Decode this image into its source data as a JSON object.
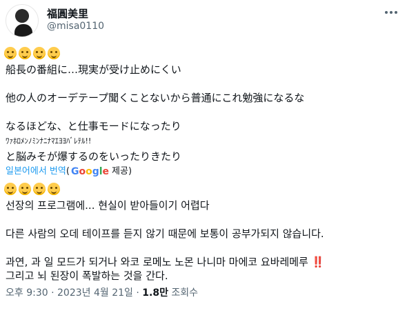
{
  "user": {
    "name": "福圓美里",
    "handle": "@misa0110"
  },
  "tweet": {
    "original": [
      "船長の番組に…現実が受け止めにくい",
      "他の人のオーデテープ聞くことないから普通にこれ勉強になるな",
      "なるほどな、と仕事モードになったり",
      "ﾜｧﾎﾛﾒﾝﾉﾐﾝﾅﾆﾅﾏｴﾖﾖﾊﾞﾚﾃﾙ!!",
      "と脳みそが爆するのをいったりきたり"
    ],
    "translate_link": "일본어에서 번역",
    "translate_prefix": "(",
    "google_letters": [
      "G",
      "o",
      "o",
      "g",
      "l",
      "e"
    ],
    "translate_suffix": "제공)",
    "translated": [
      "선장의 프로그램에... 현실이 받아들이기 어렵다",
      "다른 사람의 오데 테이프를 듣지 않기 때문에 보통이 공부가되지 않습니다.",
      "과연, 과 일 모드가 되거나 와코 로메노 노몬 나니마 마에코 요바레메루",
      "그리고 뇌 된장이 폭발하는 것을 간다."
    ],
    "bang": "‼️"
  },
  "meta": {
    "time": "오후 9:30",
    "sep1": "·",
    "date": "2023년 4월 21일",
    "sep2": "·",
    "views": "1.8만",
    "views_label": "조회수"
  },
  "icons": {
    "more": "more-horizontal-icon",
    "emoji": "smiling-face-emoji"
  }
}
